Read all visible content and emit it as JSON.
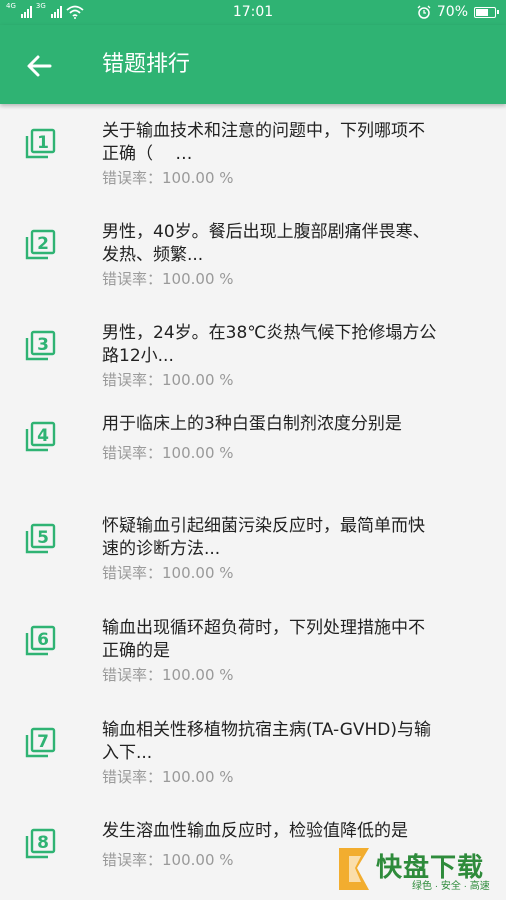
{
  "status_bar": {
    "network_left": "4G",
    "network_right": "3G",
    "time": "17:01",
    "battery_percent_text": "70%",
    "battery_level": 0.7
  },
  "appbar": {
    "title": "错题排行",
    "back_icon": "arrow-left-icon"
  },
  "colors": {
    "primary": "#2fb373",
    "rate_text": "#9a9a9a",
    "question_text": "#222222"
  },
  "items": [
    {
      "number": "1",
      "line1": "关于输血技术和注意的问题中，下列哪项不",
      "line2": "正确（　 …",
      "rate": "错误率：100.00 %"
    },
    {
      "number": "2",
      "line1": "男性，40岁。餐后出现上腹部剧痛伴畏寒、",
      "line2": "发热、频繁...",
      "rate": "错误率：100.00 %"
    },
    {
      "number": "3",
      "line1": "男性，24岁。在38℃炎热气候下抢修塌方公",
      "line2": "路12小...",
      "rate": "错误率：100.00 %"
    },
    {
      "number": "4",
      "line1": "用于临床上的3种白蛋白制剂浓度分别是",
      "line2": "",
      "rate": "错误率：100.00 %"
    },
    {
      "number": "5",
      "line1": "怀疑输血引起细菌污染反应时，最简单而快",
      "line2": "速的诊断方法...",
      "rate": "错误率：100.00 %"
    },
    {
      "number": "6",
      "line1": "输血出现循环超负荷时，下列处理措施中不",
      "line2": "正确的是",
      "rate": "错误率：100.00 %"
    },
    {
      "number": "7",
      "line1": "输血相关性移植物抗宿主病(TA-GVHD)与输",
      "line2": "入下...",
      "rate": "错误率：100.00 %"
    },
    {
      "number": "8",
      "line1": "发生溶血性输血反应时，检验值降低的是",
      "line2": "",
      "rate": "错误率：100.00 %"
    }
  ],
  "watermark": {
    "brand": "快盘下载",
    "slogan": "绿色 · 安全 · 高速"
  }
}
